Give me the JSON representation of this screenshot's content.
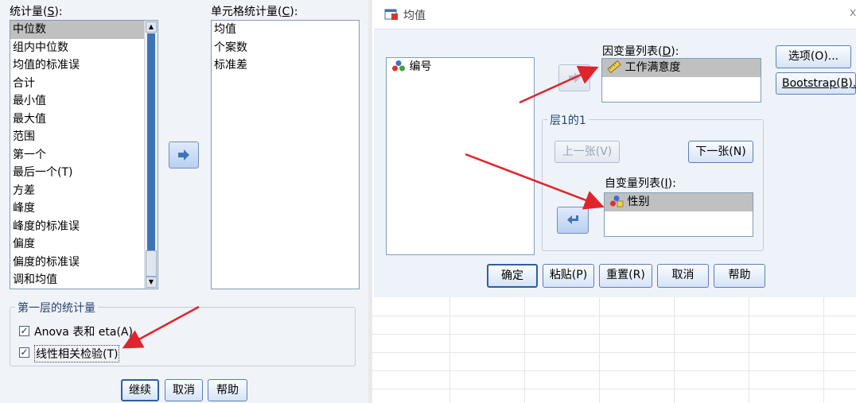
{
  "left_panel": {
    "stats_label_prefix": "统计量(",
    "stats_label_key": "S",
    "stats_label_suffix": "):",
    "stats_items": [
      "中位数",
      "组内中位数",
      "均值的标准误",
      "合计",
      "最小值",
      "最大值",
      "范围",
      "第一个",
      "最后一个(T)",
      "方差",
      "峰度",
      "峰度的标准误",
      "偏度",
      "偏度的标准误",
      "调和均值"
    ],
    "cell_label_prefix": "单元格统计量(",
    "cell_label_key": "C",
    "cell_label_suffix": "):",
    "cell_items": [
      "均值",
      "个案数",
      "标准差"
    ],
    "layer_group_legend": "第一层的统计量",
    "anova_label": "Anova 表和 eta(A)",
    "anova_checked": true,
    "linear_label": "线性相关检验(T)",
    "linear_checked": true,
    "continue_label": "继续",
    "cancel_label": "取消",
    "help_label": "帮助"
  },
  "dialog": {
    "title": "均值",
    "source_items": [
      "编号"
    ],
    "dependent_label_prefix": "因变量列表(",
    "dependent_label_key": "D",
    "dependent_label_suffix": "):",
    "dependent_items": [
      "工作满意度"
    ],
    "layer_legend": "层1的1",
    "prev_label": "上一张(V)",
    "next_label": "下一张(N)",
    "independent_label_prefix": "自变量列表(",
    "independent_label_key": "I",
    "independent_label_suffix": "):",
    "independent_items": [
      "性别"
    ],
    "options_label": "选项(O)...",
    "bootstrap_label": "Bootstrap(B)...",
    "ok_label": "确定",
    "paste_label": "粘贴(P)",
    "reset_label": "重置(R)",
    "cancel_label": "取消",
    "help_label": "帮助",
    "close_glyph": "x"
  },
  "colors": {
    "annotation_red": "#e0242c",
    "button_blue": "#3f73b8",
    "selection_gray": "#c0c0c0"
  },
  "icons": [
    "move-right-arrow-icon",
    "move-left-arrow-icon",
    "nominal-variable-icon",
    "scale-variable-icon",
    "means-dialog-icon",
    "close-icon"
  ]
}
